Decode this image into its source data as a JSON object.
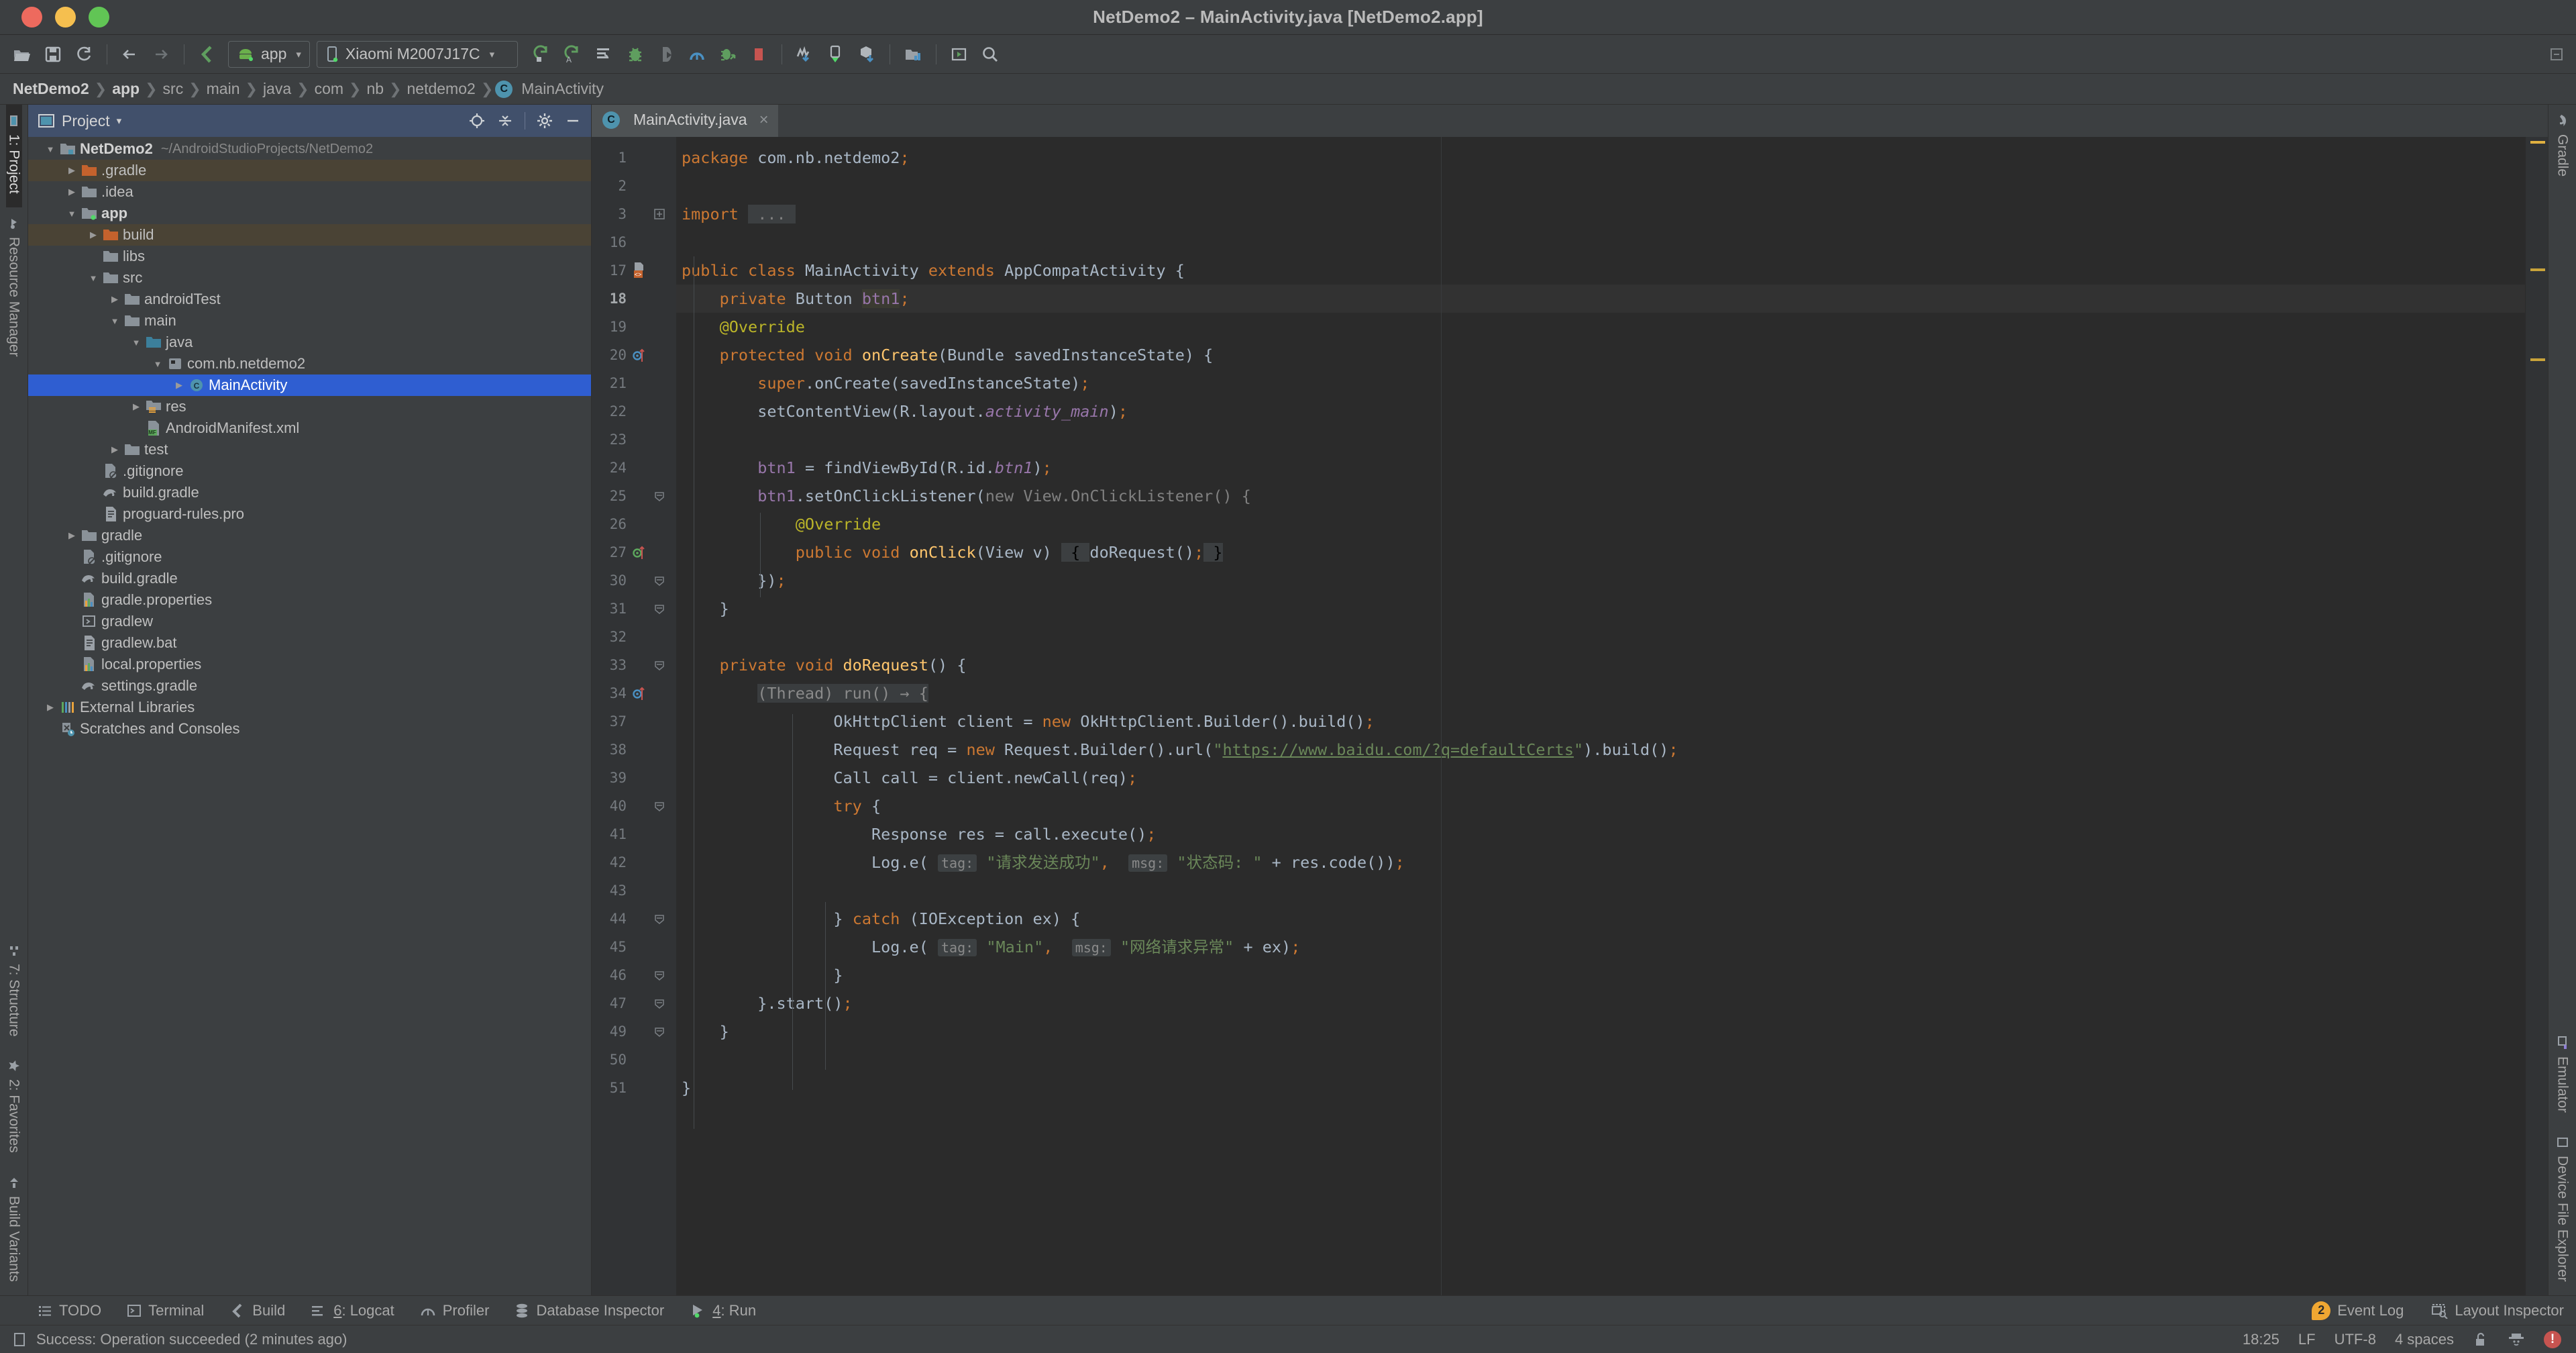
{
  "window": {
    "title": "NetDemo2 – MainActivity.java [NetDemo2.app]",
    "traffic_colors": {
      "close": "#ed6a5e",
      "minimize": "#f5bf4f",
      "maximize": "#61c555"
    }
  },
  "toolbar": {
    "icons": [
      {
        "name": "open-folder-icon",
        "label": "Open"
      },
      {
        "name": "save-all-icon",
        "label": "Save All"
      },
      {
        "name": "sync-refresh-icon",
        "label": "Sync Project with Gradle Files"
      },
      {
        "name": "back-arrow-icon",
        "label": "Back"
      },
      {
        "name": "forward-arrow-icon",
        "label": "Forward"
      },
      {
        "name": "avd-manager-icon",
        "label": "AVD Manager"
      }
    ],
    "module_selector": {
      "label": "app",
      "caret": "▾"
    },
    "device_selector": {
      "label": "Xiaomi M2007J17C",
      "caret": "▾"
    },
    "run_icons": [
      {
        "name": "run-icon",
        "label": "Run 'app'"
      },
      {
        "name": "apply-changes-icon",
        "label": "Apply Changes"
      },
      {
        "name": "run-with-coverage-icon",
        "label": "Run with Coverage"
      },
      {
        "name": "debug-icon",
        "label": "Debug 'app'"
      },
      {
        "name": "attach-debugger-icon",
        "label": "Attach Debugger to Android Process"
      },
      {
        "name": "profiler-icon",
        "label": "Profile 'app'"
      },
      {
        "name": "debug-attach-icon",
        "label": "Debug Attach"
      },
      {
        "name": "stop-icon",
        "label": "Stop"
      },
      {
        "name": "sdk-manager-icon",
        "label": "SDK Manager"
      },
      {
        "name": "device-manager-icon",
        "label": "Device Manager"
      },
      {
        "name": "gradle-sync-download-icon",
        "label": "Gradle Sync"
      },
      {
        "name": "project-structure-icon",
        "label": "Project Structure"
      },
      {
        "name": "layout-editor-icon",
        "label": "Layout Editor"
      },
      {
        "name": "search-icon",
        "label": "Search Everywhere"
      }
    ]
  },
  "breadcrumb": {
    "items": [
      {
        "label": "NetDemo2",
        "bold": true
      },
      {
        "label": "app",
        "bold": true
      },
      {
        "label": "src",
        "bold": false
      },
      {
        "label": "main",
        "bold": false
      },
      {
        "label": "java",
        "bold": false
      },
      {
        "label": "com",
        "bold": false
      },
      {
        "label": "nb",
        "bold": false
      },
      {
        "label": "netdemo2",
        "bold": false
      }
    ],
    "final": {
      "badge": "C",
      "label": "MainActivity"
    },
    "separator": "❯"
  },
  "left_strip": {
    "top": [
      {
        "label": "1: Project",
        "icon": "project-icon",
        "active": true
      },
      {
        "label": "Resource Manager",
        "icon": "resource-manager-icon",
        "active": false
      }
    ],
    "bottom": [
      {
        "label": "7: Structure",
        "icon": "structure-icon",
        "active": false
      },
      {
        "label": "2: Favorites",
        "icon": "star-icon",
        "active": false
      },
      {
        "label": "Build Variants",
        "icon": "build-variants-icon",
        "active": false
      }
    ]
  },
  "right_strip": {
    "top": [
      {
        "label": "Gradle",
        "icon": "gradle-elephant-icon",
        "active": false
      }
    ],
    "bottom": [
      {
        "label": "Emulator",
        "icon": "emulator-icon",
        "active": false
      },
      {
        "label": "Device File Explorer",
        "icon": "device-file-explorer-icon",
        "active": false
      }
    ]
  },
  "project_panel": {
    "header": {
      "title": "Project",
      "view_icon": "project-view-icon",
      "caret": "▾"
    },
    "header_actions": [
      {
        "name": "locate-icon",
        "label": "Select Opened File"
      },
      {
        "name": "collapse-all-icon",
        "label": "Collapse All"
      },
      {
        "name": "gear-icon",
        "label": "Settings"
      },
      {
        "name": "minimize-icon",
        "label": "Hide"
      }
    ],
    "tree": [
      {
        "label": "NetDemo2",
        "sub": "~/AndroidStudioProjects/NetDemo2",
        "depth": 0,
        "arrow": "open",
        "icon": "module-folder-icon",
        "bold": true,
        "state": "none"
      },
      {
        "label": ".gradle",
        "sub": "",
        "depth": 1,
        "arrow": "closed",
        "icon": "orange-folder-icon",
        "bold": false,
        "state": "highlight"
      },
      {
        "label": ".idea",
        "sub": "",
        "depth": 1,
        "arrow": "closed",
        "icon": "folder-icon",
        "bold": false,
        "state": "none"
      },
      {
        "label": "app",
        "sub": "",
        "depth": 1,
        "arrow": "open",
        "icon": "module-app-icon",
        "bold": true,
        "state": "none"
      },
      {
        "label": "build",
        "sub": "",
        "depth": 2,
        "arrow": "closed",
        "icon": "orange-folder-icon",
        "bold": false,
        "state": "highlight"
      },
      {
        "label": "libs",
        "sub": "",
        "depth": 2,
        "arrow": "none",
        "icon": "folder-icon",
        "bold": false,
        "state": "none"
      },
      {
        "label": "src",
        "sub": "",
        "depth": 2,
        "arrow": "open",
        "icon": "folder-icon",
        "bold": false,
        "state": "none"
      },
      {
        "label": "androidTest",
        "sub": "",
        "depth": 3,
        "arrow": "closed",
        "icon": "folder-icon",
        "bold": false,
        "state": "none"
      },
      {
        "label": "main",
        "sub": "",
        "depth": 3,
        "arrow": "open",
        "icon": "folder-icon",
        "bold": false,
        "state": "none"
      },
      {
        "label": "java",
        "sub": "",
        "depth": 4,
        "arrow": "open",
        "icon": "source-folder-icon",
        "bold": false,
        "state": "none"
      },
      {
        "label": "com.nb.netdemo2",
        "sub": "",
        "depth": 5,
        "arrow": "open",
        "icon": "package-icon",
        "bold": false,
        "state": "none"
      },
      {
        "label": "MainActivity",
        "sub": "",
        "depth": 6,
        "arrow": "closed",
        "icon": "class-icon",
        "bold": false,
        "state": "selected"
      },
      {
        "label": "res",
        "sub": "",
        "depth": 4,
        "arrow": "closed",
        "icon": "res-folder-icon",
        "bold": false,
        "state": "none"
      },
      {
        "label": "AndroidManifest.xml",
        "sub": "",
        "depth": 4,
        "arrow": "none",
        "icon": "manifest-icon",
        "bold": false,
        "state": "none"
      },
      {
        "label": "test",
        "sub": "",
        "depth": 3,
        "arrow": "closed",
        "icon": "folder-icon",
        "bold": false,
        "state": "none"
      },
      {
        "label": ".gitignore",
        "sub": "",
        "depth": 2,
        "arrow": "none",
        "icon": "gitignore-icon",
        "bold": false,
        "state": "none"
      },
      {
        "label": "build.gradle",
        "sub": "",
        "depth": 2,
        "arrow": "none",
        "icon": "gradle-file-icon",
        "bold": false,
        "state": "none"
      },
      {
        "label": "proguard-rules.pro",
        "sub": "",
        "depth": 2,
        "arrow": "none",
        "icon": "text-file-icon",
        "bold": false,
        "state": "none"
      },
      {
        "label": "gradle",
        "sub": "",
        "depth": 1,
        "arrow": "closed",
        "icon": "folder-icon",
        "bold": false,
        "state": "none"
      },
      {
        "label": ".gitignore",
        "sub": "",
        "depth": 1,
        "arrow": "none",
        "icon": "gitignore-icon",
        "bold": false,
        "state": "none"
      },
      {
        "label": "build.gradle",
        "sub": "",
        "depth": 1,
        "arrow": "none",
        "icon": "gradle-file-icon",
        "bold": false,
        "state": "none"
      },
      {
        "label": "gradle.properties",
        "sub": "",
        "depth": 1,
        "arrow": "none",
        "icon": "properties-icon",
        "bold": false,
        "state": "none"
      },
      {
        "label": "gradlew",
        "sub": "",
        "depth": 1,
        "arrow": "none",
        "icon": "shell-script-icon",
        "bold": false,
        "state": "none"
      },
      {
        "label": "gradlew.bat",
        "sub": "",
        "depth": 1,
        "arrow": "none",
        "icon": "text-file-icon",
        "bold": false,
        "state": "none"
      },
      {
        "label": "local.properties",
        "sub": "",
        "depth": 1,
        "arrow": "none",
        "icon": "properties-icon",
        "bold": false,
        "state": "none"
      },
      {
        "label": "settings.gradle",
        "sub": "",
        "depth": 1,
        "arrow": "none",
        "icon": "gradle-file-icon",
        "bold": false,
        "state": "none"
      },
      {
        "label": "External Libraries",
        "sub": "",
        "depth": 0,
        "arrow": "closed",
        "icon": "external-libraries-icon",
        "bold": false,
        "state": "none"
      },
      {
        "label": "Scratches and Consoles",
        "sub": "",
        "depth": 0,
        "arrow": "none",
        "icon": "scratches-icon",
        "bold": false,
        "state": "none"
      }
    ]
  },
  "editor": {
    "tabs": [
      {
        "label": "MainActivity.java",
        "badge": "C",
        "active": true,
        "close": "×"
      }
    ],
    "current_line": 18,
    "line_numbers": [
      1,
      2,
      3,
      16,
      17,
      18,
      19,
      20,
      21,
      22,
      23,
      24,
      25,
      26,
      27,
      30,
      31,
      32,
      33,
      34,
      37,
      38,
      39,
      40,
      41,
      42,
      43,
      44,
      45,
      46,
      47,
      49,
      50,
      51
    ],
    "gutter_marks": {
      "3": "fold-collapsed-icon",
      "17": "class-marker-icon",
      "20": "override-marker-icon",
      "25": "fold-icon",
      "27": "implement-marker-icon",
      "30": "fold-icon",
      "31": "fold-icon",
      "33": "fold-icon",
      "34": "override-marker-icon",
      "40": "fold-icon",
      "44": "fold-icon",
      "46": "fold-icon",
      "47": "fold-icon",
      "49": "fold-icon"
    },
    "code_lines": [
      {
        "n": 1,
        "text": "package com.nb.netdemo2;"
      },
      {
        "n": 2,
        "text": ""
      },
      {
        "n": 3,
        "text": "import ..."
      },
      {
        "n": 16,
        "text": ""
      },
      {
        "n": 17,
        "text": "public class MainActivity extends AppCompatActivity {"
      },
      {
        "n": 18,
        "text": "    private Button btn1;"
      },
      {
        "n": 19,
        "text": "    @Override"
      },
      {
        "n": 20,
        "text": "    protected void onCreate(Bundle savedInstanceState) {"
      },
      {
        "n": 21,
        "text": "        super.onCreate(savedInstanceState);"
      },
      {
        "n": 22,
        "text": "        setContentView(R.layout.activity_main);"
      },
      {
        "n": 23,
        "text": ""
      },
      {
        "n": 24,
        "text": "        btn1 = findViewById(R.id.btn1);"
      },
      {
        "n": 25,
        "text": "        btn1.setOnClickListener(new View.OnClickListener() {"
      },
      {
        "n": 26,
        "text": "            @Override"
      },
      {
        "n": 27,
        "text": "            public void onClick(View v) { doRequest(); }"
      },
      {
        "n": 30,
        "text": "        });"
      },
      {
        "n": 31,
        "text": "    }"
      },
      {
        "n": 32,
        "text": ""
      },
      {
        "n": 33,
        "text": "    private void doRequest() {"
      },
      {
        "n": 34,
        "text": "        (Thread) run() → {"
      },
      {
        "n": 37,
        "text": "                OkHttpClient client = new OkHttpClient.Builder().build();"
      },
      {
        "n": 38,
        "text": "                Request req = new Request.Builder().url(\"https://www.baidu.com/?q=defaultCerts\").build();"
      },
      {
        "n": 39,
        "text": "                Call call = client.newCall(req);"
      },
      {
        "n": 40,
        "text": "                try {"
      },
      {
        "n": 41,
        "text": "                    Response res = call.execute();"
      },
      {
        "n": 42,
        "text": "                    Log.e( tag: \"请求发送成功\",  msg: \"状态码: \" + res.code());"
      },
      {
        "n": 43,
        "text": ""
      },
      {
        "n": 44,
        "text": "                } catch (IOException ex) {"
      },
      {
        "n": 45,
        "text": "                    Log.e( tag: \"Main\",  msg: \"网络请求异常\" + ex);"
      },
      {
        "n": 46,
        "text": "                }"
      },
      {
        "n": 47,
        "text": "        }.start();"
      },
      {
        "n": 49,
        "text": "    }"
      },
      {
        "n": 50,
        "text": ""
      },
      {
        "n": 51,
        "text": "}"
      }
    ],
    "strings": {
      "url": "https://www.baidu.com/?q=defaultCerts",
      "tag_success": "请求发送成功",
      "msg_status": "状态码: ",
      "tag_main": "Main",
      "msg_error": "网络请求异常",
      "hint_tag": "tag:",
      "hint_msg": "msg:"
    },
    "colors": {
      "background": "#2b2b2b",
      "gutter": "#313335",
      "keyword": "#cc7832",
      "plain": "#a9b7c6",
      "method": "#ffc66d",
      "field": "#9876aa",
      "string": "#6a8759",
      "annotation": "#bbb529",
      "comment": "#808080",
      "number": "#6897bb",
      "selection": "#2f5ed1",
      "current_line": "#323232"
    }
  },
  "tool_windows": {
    "items": [
      {
        "label": "TODO",
        "icon": "todo-icon",
        "mnemonic": ""
      },
      {
        "label": "Terminal",
        "icon": "terminal-icon",
        "mnemonic": ""
      },
      {
        "label": "Build",
        "icon": "build-hammer-icon",
        "mnemonic": ""
      },
      {
        "label": "6: Logcat",
        "icon": "logcat-icon",
        "mnemonic": "6"
      },
      {
        "label": "Profiler",
        "icon": "profiler-icon",
        "mnemonic": ""
      },
      {
        "label": "Database Inspector",
        "icon": "database-icon",
        "mnemonic": ""
      },
      {
        "label": "4: Run",
        "icon": "run-green-icon",
        "mnemonic": "4"
      }
    ],
    "right_items": [
      {
        "label": "Event Log",
        "icon": "event-log-icon",
        "count": "2"
      },
      {
        "label": "Layout Inspector",
        "icon": "layout-inspector-icon",
        "count": ""
      }
    ]
  },
  "status_bar": {
    "message": "Success: Operation succeeded (2 minutes ago)",
    "message_icon": "notification-icon",
    "time": "18:25",
    "line_separator": "LF",
    "encoding": "UTF-8",
    "indent": "4 spaces",
    "lock_icon": "unlocked-icon",
    "inspector_icon": "inspector-hat-icon",
    "error_badge": "!"
  }
}
